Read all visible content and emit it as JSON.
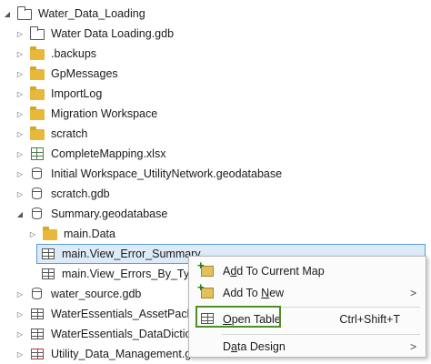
{
  "tree": {
    "root": "Water_Data_Loading",
    "items": [
      {
        "label": "Water Data Loading.gdb"
      },
      {
        "label": ".backups"
      },
      {
        "label": "GpMessages"
      },
      {
        "label": "ImportLog"
      },
      {
        "label": "Migration Workspace"
      },
      {
        "label": "scratch"
      },
      {
        "label": "CompleteMapping.xlsx"
      },
      {
        "label": "Initial Workspace_UtilityNetwork.geodatabase"
      },
      {
        "label": "scratch.gdb"
      },
      {
        "label": "Summary.geodatabase"
      },
      {
        "label": "main.Data"
      },
      {
        "label": "main.View_Error_Summary"
      },
      {
        "label": "main.View_Errors_By_Type"
      },
      {
        "label": "water_source.gdb"
      },
      {
        "label": "WaterEssentials_AssetPackage.gdb"
      },
      {
        "label": "WaterEssentials_DataDictionary.gdb"
      },
      {
        "label": "Utility_Data_Management.gdb"
      }
    ]
  },
  "context_menu": {
    "add_to_current_map": {
      "pre": "A",
      "u": "d",
      "post": "d To Current Map"
    },
    "add_to_new": {
      "pre": "Add To ",
      "u": "N",
      "post": "ew"
    },
    "open_table": {
      "pre": "",
      "u": "O",
      "post": "pen Table",
      "shortcut": "Ctrl+Shift+T"
    },
    "data_design": {
      "pre": "D",
      "u": "a",
      "post": "ta Design"
    }
  },
  "colors": {
    "selection_bg": "#dcebf7",
    "selection_border": "#5a9bd8",
    "highlight_box": "#4f8f26",
    "folder": "#e8b83a"
  }
}
